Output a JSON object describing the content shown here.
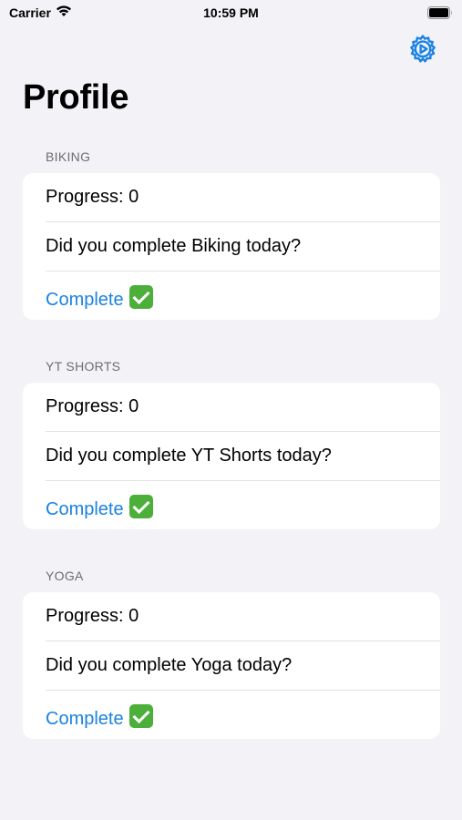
{
  "status_bar": {
    "carrier": "Carrier",
    "time": "10:59 PM"
  },
  "header": {
    "title": "Profile",
    "settings_icon": "gear-play-icon",
    "accent_color": "#1a82e2"
  },
  "sections": [
    {
      "header": "BIKING",
      "progress": "Progress: 0",
      "question": "Did you complete Biking today?",
      "action_label": "Complete",
      "action_icon": "check-mark-emoji"
    },
    {
      "header": "YT SHORTS",
      "progress": "Progress: 0",
      "question": "Did you complete YT Shorts today?",
      "action_label": "Complete",
      "action_icon": "check-mark-emoji"
    },
    {
      "header": "YOGA",
      "progress": "Progress: 0",
      "question": "Did you complete Yoga today?",
      "action_label": "Complete",
      "action_icon": "check-mark-emoji"
    }
  ]
}
